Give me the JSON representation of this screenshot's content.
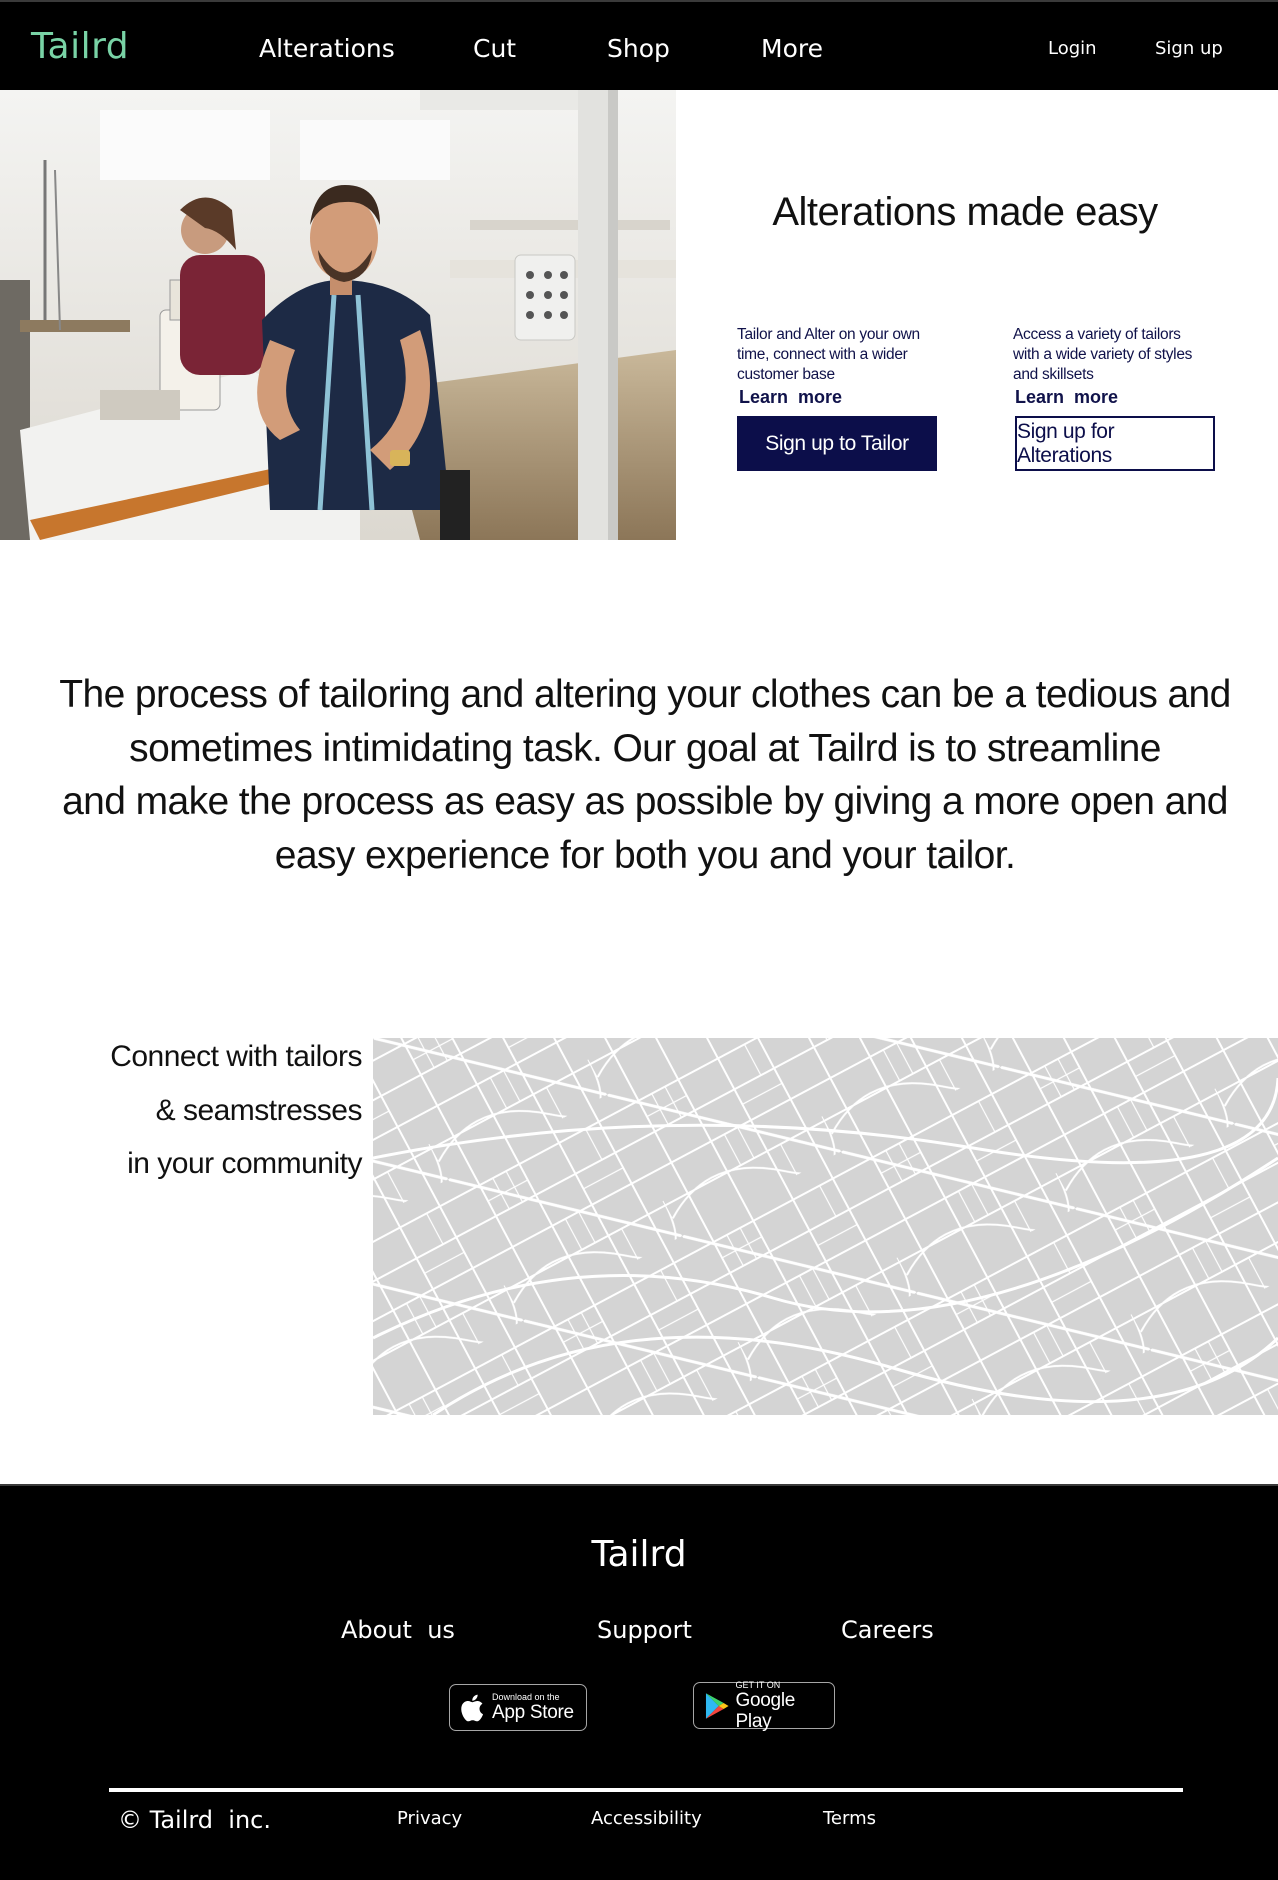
{
  "header": {
    "logo": "Tailrd",
    "nav": [
      "Alterations",
      "Cut",
      "Shop",
      "More"
    ],
    "login": "Login",
    "signup": "Sign up"
  },
  "hero": {
    "title": "Alterations made easy",
    "tailor": {
      "description": "Tailor and Alter on your own time, connect with a wider customer base",
      "learn_more": "Learn  more",
      "button": "Sign up to Tailor"
    },
    "alterations": {
      "description": "Access a variety of tailors with a wide variety of styles and skillsets",
      "learn_more": "Learn  more",
      "button": "Sign up for Alterations"
    }
  },
  "mission": {
    "lines": [
      "The process of tailoring and altering your clothes can be a tedious and",
      "sometimes intimidating task. Our goal at Tailrd is to streamline",
      "and make the process as easy as possible by giving a more open and",
      "easy experience for both you and your tailor."
    ]
  },
  "community": {
    "lines": [
      "Connect with tailors",
      "& seamstresses",
      "in your community"
    ]
  },
  "footer": {
    "logo": "Tailrd",
    "links": [
      "About  us",
      "Support",
      "Careers"
    ],
    "app_store": {
      "small": "Download on the",
      "big": "App Store"
    },
    "google_play": {
      "small": "GET IT ON",
      "big": "Google Play"
    },
    "copyright": "© Tailrd  inc.",
    "legal": [
      "Privacy",
      "Accessibility",
      "Terms"
    ]
  },
  "colors": {
    "logo_green": "#79d3a6",
    "navy": "#0c0e4a",
    "header_bg": "#000000",
    "map_bg": "#d4d4d4"
  }
}
